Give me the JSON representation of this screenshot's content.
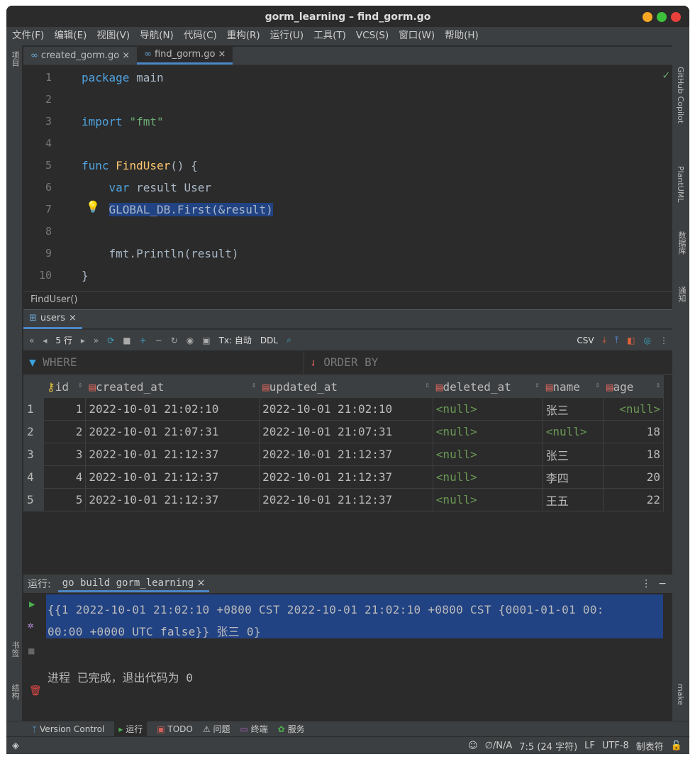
{
  "window": {
    "title": "gorm_learning – find_gorm.go"
  },
  "menu": [
    "文件(F)",
    "编辑(E)",
    "视图(V)",
    "导航(N)",
    "代码(C)",
    "重构(R)",
    "运行(U)",
    "工具(T)",
    "VCS(S)",
    "窗口(W)",
    "帮助(H)"
  ],
  "left_tools": {
    "project": "项目",
    "bookmarks": "书签",
    "structure": "结构"
  },
  "right_tools": {
    "copilot": "GitHub Copilot",
    "plantuml": "PlantUML",
    "database": "数据库",
    "notifications": "通知",
    "make": "make"
  },
  "editor": {
    "tabs": [
      {
        "label": "created_gorm.go",
        "active": false
      },
      {
        "label": "find_gorm.go",
        "active": true
      }
    ],
    "lines": [
      "package main",
      "",
      "import \"fmt\"",
      "",
      "func FindUser() {",
      "    var result User",
      "    GLOBAL_DB.First(&result)",
      "",
      "    fmt.Println(result)",
      "}"
    ],
    "breadcrumb": "FindUser()"
  },
  "db": {
    "tab": "users",
    "toolbar": {
      "rows": "5 行",
      "tx": "Tx: 自动",
      "ddl": "DDL",
      "export": "CSV"
    },
    "where": "WHERE",
    "order_by": "ORDER BY",
    "columns": [
      "id",
      "created_at",
      "updated_at",
      "deleted_at",
      "name",
      "age"
    ],
    "rows": [
      [
        "1",
        "1",
        "2022-10-01 21:02:10",
        "2022-10-01 21:02:10",
        "<null>",
        "张三",
        "<null>"
      ],
      [
        "2",
        "2",
        "2022-10-01 21:07:31",
        "2022-10-01 21:07:31",
        "<null>",
        "<null>",
        "18"
      ],
      [
        "3",
        "3",
        "2022-10-01 21:12:37",
        "2022-10-01 21:12:37",
        "<null>",
        "张三",
        "18"
      ],
      [
        "4",
        "4",
        "2022-10-01 21:12:37",
        "2022-10-01 21:12:37",
        "<null>",
        "李四",
        "20"
      ],
      [
        "5",
        "5",
        "2022-10-01 21:12:37",
        "2022-10-01 21:12:37",
        "<null>",
        "王五",
        "22"
      ]
    ]
  },
  "run": {
    "label": "运行:",
    "tab": "go build gorm_learning",
    "output_line1": "{{1 2022-10-01 21:02:10 +0800 CST 2022-10-01 21:02:10 +0800 CST {0001-01-01 00:",
    "output_line2": "00:00 +0000 UTC false}} 张三 0}",
    "exit": "进程 已完成，退出代码为 0"
  },
  "bottom_tools": [
    "Version Control",
    "运行",
    "TODO",
    "问题",
    "终端",
    "服务"
  ],
  "status": {
    "na": "∅/N/A",
    "pos": "7:5 (24 字符)",
    "lf": "LF",
    "enc": "UTF-8",
    "indent": "制表符"
  }
}
